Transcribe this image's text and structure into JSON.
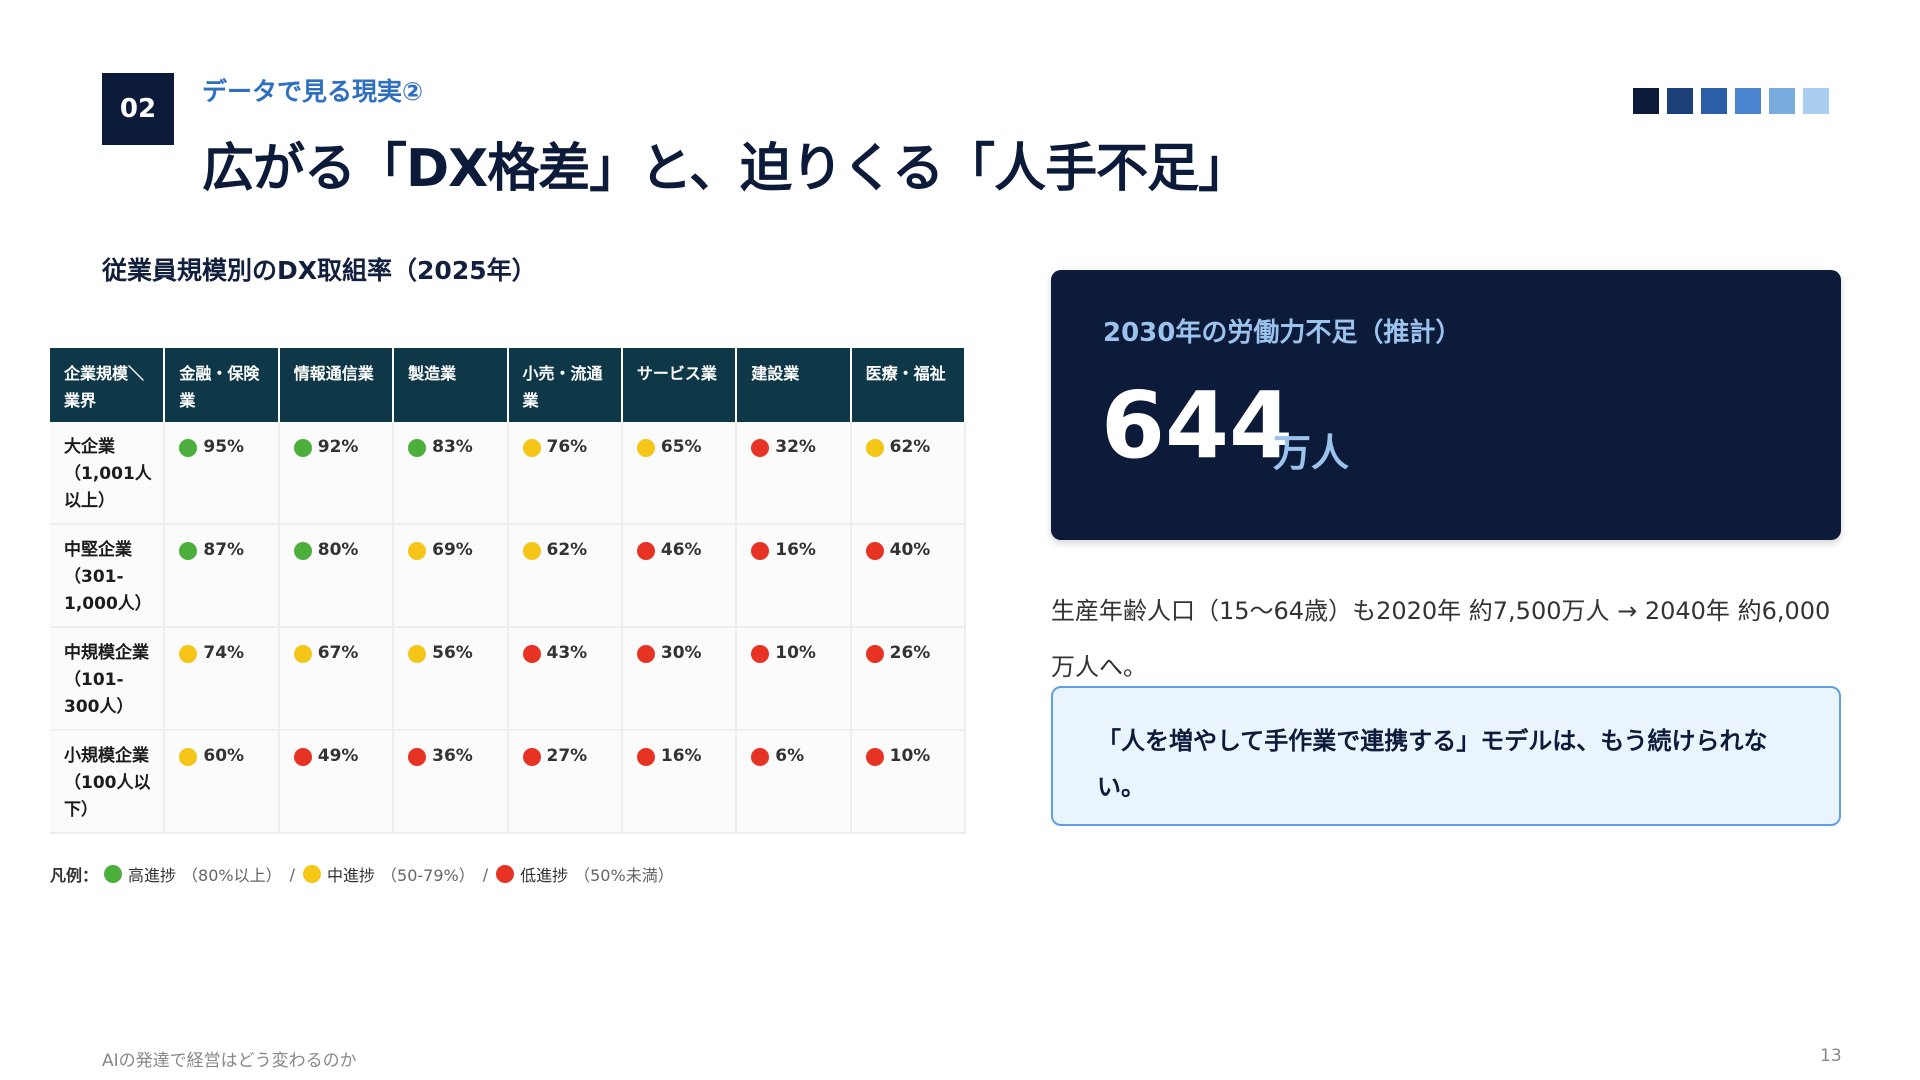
{
  "header": {
    "section_number": "02",
    "subtitle": "データで見る現実②",
    "title": "広がる「DX格差」と、迫りくる「人手不足」",
    "square_colors": [
      "#0d1b3a",
      "#1b3f77",
      "#2a5fa8",
      "#4a84cf",
      "#78acde",
      "#a9cdee"
    ]
  },
  "table": {
    "caption": "従業員規模別のDX取組率（2025年）",
    "headers": [
      "企業規模＼業界",
      "金融・保険業",
      "情報通信業",
      "製造業",
      "小売・流通業",
      "サービス業",
      "建設業",
      "医療・福祉"
    ],
    "rows": [
      {
        "label": "大企業（1,001人以上）",
        "cells": [
          {
            "value": "95%",
            "color": "#4caf3b"
          },
          {
            "value": "92%",
            "color": "#4caf3b"
          },
          {
            "value": "83%",
            "color": "#4caf3b"
          },
          {
            "value": "76%",
            "color": "#f5c518"
          },
          {
            "value": "65%",
            "color": "#f5c518"
          },
          {
            "value": "32%",
            "color": "#e63323"
          },
          {
            "value": "62%",
            "color": "#f5c518"
          }
        ]
      },
      {
        "label": "中堅企業（301-1,000人）",
        "cells": [
          {
            "value": "87%",
            "color": "#4caf3b"
          },
          {
            "value": "80%",
            "color": "#4caf3b"
          },
          {
            "value": "69%",
            "color": "#f5c518"
          },
          {
            "value": "62%",
            "color": "#f5c518"
          },
          {
            "value": "46%",
            "color": "#e63323"
          },
          {
            "value": "16%",
            "color": "#e63323"
          },
          {
            "value": "40%",
            "color": "#e63323"
          }
        ]
      },
      {
        "label": "中規模企業（101-300人）",
        "cells": [
          {
            "value": "74%",
            "color": "#f5c518"
          },
          {
            "value": "67%",
            "color": "#f5c518"
          },
          {
            "value": "56%",
            "color": "#f5c518"
          },
          {
            "value": "43%",
            "color": "#e63323"
          },
          {
            "value": "30%",
            "color": "#e63323"
          },
          {
            "value": "10%",
            "color": "#e63323"
          },
          {
            "value": "26%",
            "color": "#e63323"
          }
        ]
      },
      {
        "label": "小規模企業（100人以下）",
        "cells": [
          {
            "value": "60%",
            "color": "#f5c518"
          },
          {
            "value": "49%",
            "color": "#e63323"
          },
          {
            "value": "36%",
            "color": "#e63323"
          },
          {
            "value": "27%",
            "color": "#e63323"
          },
          {
            "value": "16%",
            "color": "#e63323"
          },
          {
            "value": "6%",
            "color": "#e63323"
          },
          {
            "value": "10%",
            "color": "#e63323"
          }
        ]
      }
    ],
    "legend": {
      "prefix": "凡例：",
      "items": [
        {
          "label": "高進捗",
          "range": "（80%以上）",
          "color": "#4caf3b"
        },
        {
          "label": "中進捗",
          "range": "（50-79%）",
          "color": "#f5c518"
        },
        {
          "label": "低進捗",
          "range": "（50%未満）",
          "color": "#e63323"
        }
      ]
    }
  },
  "stat": {
    "label": "2030年の労働力不足（推計）",
    "number": "644",
    "unit": "万人"
  },
  "body_text": "生産年齢人口（15〜64歳）も2020年 約7,500万人 → 2040年 約6,000万人へ。",
  "callout": "「人を増やして手作業で連携する」モデルは、もう続けられない。",
  "footer": {
    "left": "AIの発達で経営はどう変わるのか",
    "page": "13"
  }
}
